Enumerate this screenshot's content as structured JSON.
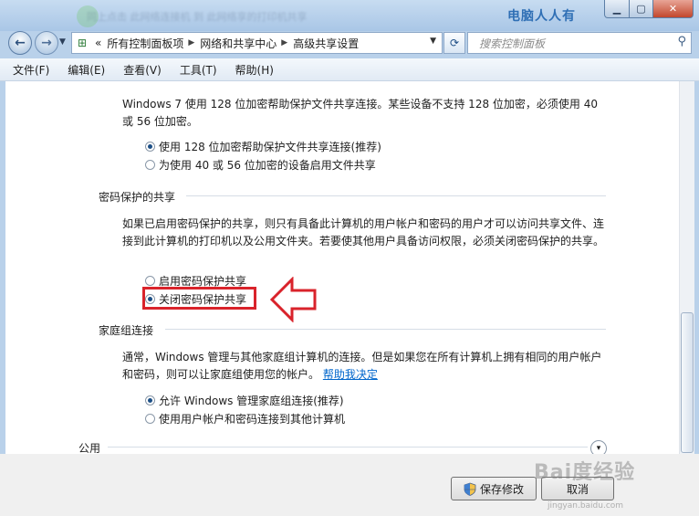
{
  "watermark_top": "电脑人人有",
  "title_blur": "同上点击  此网络连接机 到 此网络享的打印机共享",
  "address": {
    "prefix": "«",
    "segments": [
      "所有控制面板项",
      "网络和共享中心",
      "高级共享设置"
    ]
  },
  "search": {
    "placeholder": "搜索控制面板"
  },
  "menu": [
    "文件(F)",
    "编辑(E)",
    "查看(V)",
    "工具(T)",
    "帮助(H)"
  ],
  "encryption": {
    "description": "Windows 7 使用 128 位加密帮助保护文件共享连接。某些设备不支持 128 位加密，必须使用 40 或 56 位加密。",
    "options": [
      {
        "label": "使用 128 位加密帮助保护文件共享连接(推荐)",
        "checked": true
      },
      {
        "label": "为使用 40 或 56 位加密的设备启用文件共享",
        "checked": false
      }
    ]
  },
  "password_sharing": {
    "title": "密码保护的共享",
    "description": "如果已启用密码保护的共享，则只有具备此计算机的用户帐户和密码的用户才可以访问共享文件、连接到此计算机的打印机以及公用文件夹。若要使其他用户具备访问权限，必须关闭密码保护的共享。",
    "options": [
      {
        "label": "启用密码保护共享",
        "checked": false
      },
      {
        "label": "关闭密码保护共享",
        "checked": true
      }
    ]
  },
  "homegroup": {
    "title": "家庭组连接",
    "description": "通常，Windows 管理与其他家庭组计算机的连接。但是如果您在所有计算机上拥有相同的用户帐户和密码，则可以让家庭组使用您的帐户。",
    "link": "帮助我决定",
    "options": [
      {
        "label": "允许 Windows 管理家庭组连接(推荐)",
        "checked": true
      },
      {
        "label": "使用用户帐户和密码连接到其他计算机",
        "checked": false
      }
    ]
  },
  "public_section": {
    "title": "公用"
  },
  "buttons": {
    "save": "保存修改",
    "cancel": "取消"
  },
  "watermark_bottom": "Bai度经验",
  "watermark_url": "jingyan.baidu.com",
  "colors": {
    "highlight": "#d9232b",
    "link": "#0066cc",
    "window_frame": "#b9d1ea"
  }
}
